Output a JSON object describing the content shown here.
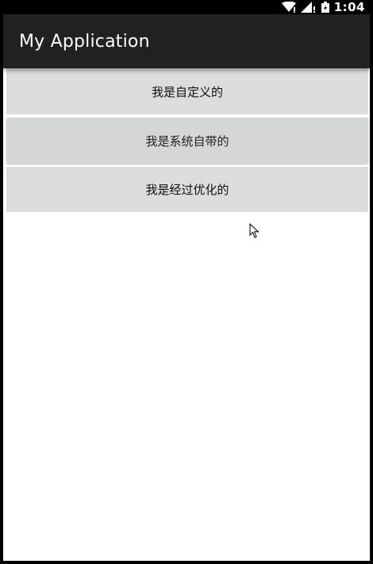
{
  "status_bar": {
    "time": "1:04",
    "icons": [
      "wifi-icon",
      "signal-icon",
      "battery-charging-icon"
    ]
  },
  "app_bar": {
    "title": "My Application"
  },
  "buttons": [
    {
      "label": "我是自定义的"
    },
    {
      "label": "我是系统自带的"
    },
    {
      "label": "我是经过优化的"
    }
  ],
  "colors": {
    "status_bar": "#000000",
    "app_bar": "#212121",
    "background": "#ffffff",
    "button": "#dcdcdc",
    "system_button": "#d5d7d6"
  }
}
